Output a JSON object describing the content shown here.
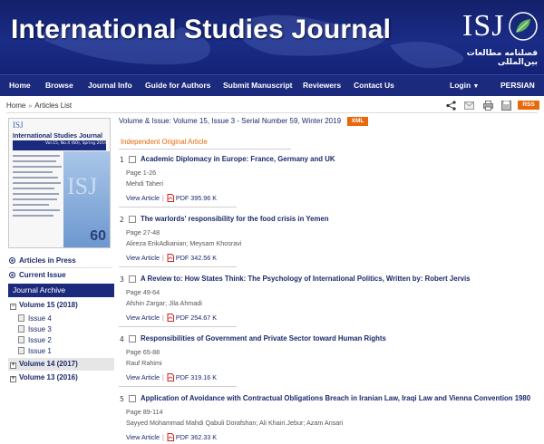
{
  "header": {
    "title": "International Studies Journal",
    "logo_text": "ISJ",
    "logo_fa_line1": "فصلنامه مطالعات",
    "logo_fa_line2": "بین‌المللی"
  },
  "nav": {
    "items": [
      "Home",
      "Browse",
      "Journal Info",
      "Guide for Authors",
      "Submit Manuscript",
      "Reviewers",
      "Contact Us"
    ],
    "login": "Login",
    "language": "PERSIAN",
    "brand_color": "#1b2a7c"
  },
  "breadcrumb": {
    "home": "Home",
    "current": "Articles List"
  },
  "toolbar": {
    "rss": "RSS"
  },
  "cover": {
    "logo": "ISJ",
    "title": "International Studies Journal",
    "vol": "Vol.15, No.4 (60), Spring 2019",
    "watermark": "ISJ",
    "number": "60"
  },
  "sidebar": {
    "articles_in_press": "Articles in Press",
    "current_issue": "Current Issue",
    "archive_title": "Journal Archive",
    "volumes": [
      {
        "label": "Volume 15 (2018)",
        "expanded": true,
        "issues": [
          "Issue 4",
          "Issue 3",
          "Issue 2",
          "Issue 1"
        ]
      },
      {
        "label": "Volume 14 (2017)",
        "expanded": false
      },
      {
        "label": "Volume 13 (2016)",
        "expanded": false
      }
    ]
  },
  "main": {
    "volume_line": "Volume & Issue: Volume 15, Issue 3 - Serial Number 59, Winter 2019",
    "xml": "XML",
    "section": "Independent Original Article",
    "view_label": "View Article",
    "pdf_label": "PDF",
    "articles": [
      {
        "num": "1",
        "title": "Academic Diplomacy in Europe: France, Germany and UK",
        "pages": "Page 1-26",
        "authors": "Mehdi Taheri",
        "size": "395.96 K"
      },
      {
        "num": "2",
        "title": "The warlords' responsibility for the food crisis in Yemen",
        "pages": "Page 27-48",
        "authors": "Alireza ErikAdkanian;  Meysam Khosravi",
        "size": "342.56 K"
      },
      {
        "num": "3",
        "title": "A Review to: How States Think: The Psychology of International Politics, Written by: Robert Jervis",
        "pages": "Page 49-64",
        "authors": "Afshin Zargar;  Jila Ahmadi",
        "size": "254.67 K"
      },
      {
        "num": "4",
        "title": "Responsibilities of Government and Private Sector toward Human Rights",
        "pages": "Page 65-88",
        "authors": "Rauf Rahimi",
        "size": "319.16 K"
      },
      {
        "num": "5",
        "title": "Application of Avoidance with Contractual Obligations Breach in Iranian Law, Iraqi Law and Vienna Convention 1980",
        "pages": "Page 89-114",
        "authors": "Sayyed Mohammad Mahdi Qabuli Dorafshan;  Ali Khairi.Jebur;  Azam Ansari",
        "size": "362.33 K"
      }
    ]
  }
}
